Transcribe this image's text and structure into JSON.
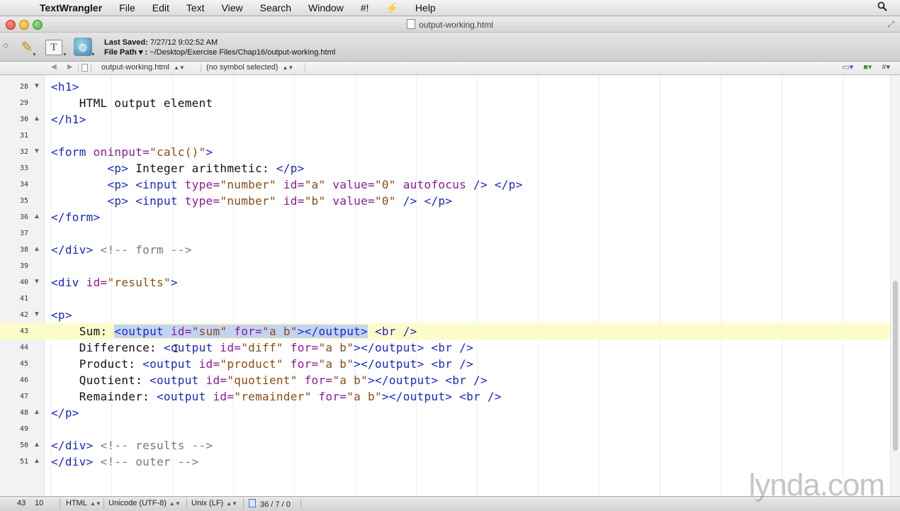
{
  "menubar": {
    "apple": "",
    "app_name": "TextWrangler",
    "items": [
      "File",
      "Edit",
      "Text",
      "View",
      "Search",
      "Window",
      "#!",
      "⚡",
      "Help"
    ],
    "spotlight_icon": "search-icon"
  },
  "window": {
    "title": "output-working.html"
  },
  "toolbar": {
    "last_saved_label": "Last Saved:",
    "last_saved_value": "7/27/12 9:02:52 AM",
    "file_path_label": "File Path ▾ :",
    "file_path_value": "~/Desktop/Exercise Files/Chap16/output-working.html"
  },
  "navbar": {
    "file": "output-working.html",
    "symbol": "(no symbol selected)"
  },
  "editor": {
    "current_line": 43,
    "lines": [
      {
        "n": "28",
        "fold": "▼"
      },
      {
        "n": "29",
        "fold": ""
      },
      {
        "n": "30",
        "fold": "▲"
      },
      {
        "n": "31",
        "fold": ""
      },
      {
        "n": "32",
        "fold": "▼"
      },
      {
        "n": "33",
        "fold": ""
      },
      {
        "n": "34",
        "fold": ""
      },
      {
        "n": "35",
        "fold": ""
      },
      {
        "n": "36",
        "fold": "▲"
      },
      {
        "n": "37",
        "fold": ""
      },
      {
        "n": "38",
        "fold": "▲"
      },
      {
        "n": "39",
        "fold": ""
      },
      {
        "n": "40",
        "fold": "▼"
      },
      {
        "n": "41",
        "fold": ""
      },
      {
        "n": "42",
        "fold": "▼"
      },
      {
        "n": "43",
        "fold": ""
      },
      {
        "n": "44",
        "fold": ""
      },
      {
        "n": "45",
        "fold": ""
      },
      {
        "n": "46",
        "fold": ""
      },
      {
        "n": "47",
        "fold": ""
      },
      {
        "n": "48",
        "fold": "▲"
      },
      {
        "n": "49",
        "fold": ""
      },
      {
        "n": "50",
        "fold": "▲"
      },
      {
        "n": "51",
        "fold": "▲"
      }
    ],
    "code": {
      "l28": "<h1>",
      "l29": "    HTML output element",
      "l30": "</h1>",
      "l32_tag": "<form ",
      "l32_attr": "oninput=",
      "l32_str": "\"calc()\"",
      "l32_end": ">",
      "l33_indent": "        ",
      "l33_open": "<p>",
      "l33_text": " Integer arithmetic: ",
      "l33_close": "</p>",
      "l34_indent": "        ",
      "l34_p": "<p>",
      "l34_input": " <input ",
      "l34_type": "type=",
      "l34_typev": "\"number\"",
      "l34_id": " id=",
      "l34_idv": "\"a\"",
      "l34_val": " value=",
      "l34_valv": "\"0\"",
      "l34_auto": " autofocus",
      "l34_end": " /> </p>",
      "l35_indent": "        ",
      "l35_p": "<p>",
      "l35_input": " <input ",
      "l35_type": "type=",
      "l35_typev": "\"number\"",
      "l35_id": " id=",
      "l35_idv": "\"b\"",
      "l35_val": " value=",
      "l35_valv": "\"0\"",
      "l35_end": " /> </p>",
      "l36": "</form>",
      "l38_tag": "</div>",
      "l38_cmt": " <!-- form -->",
      "l40_tag": "<div ",
      "l40_attr": "id=",
      "l40_str": "\"results\"",
      "l40_end": ">",
      "l42": "<p>",
      "l43_text": "    Sum: ",
      "l43_o1": "<output ",
      "l43_a1": "id=",
      "l43_s1": "\"sum\"",
      "l43_a2": " for=",
      "l43_s2": "\"a b\"",
      "l43_o2": "></output>",
      "l43_br": " <br />",
      "l44_text": "    Difference: ",
      "l44_o1": "<output ",
      "l44_a1": "id=",
      "l44_s1": "\"diff\"",
      "l44_a2": " for=",
      "l44_s2": "\"a b\"",
      "l44_o2": "></output>",
      "l44_br": " <br />",
      "l45_text": "    Product: ",
      "l45_o1": "<output ",
      "l45_a1": "id=",
      "l45_s1": "\"product\"",
      "l45_a2": " for=",
      "l45_s2": "\"a b\"",
      "l45_o2": "></output>",
      "l45_br": " <br />",
      "l46_text": "    Quotient: ",
      "l46_o1": "<output ",
      "l46_a1": "id=",
      "l46_s1": "\"quotient\"",
      "l46_a2": " for=",
      "l46_s2": "\"a b\"",
      "l46_o2": "></output>",
      "l46_br": " <br />",
      "l47_text": "    Remainder: ",
      "l47_o1": "<output ",
      "l47_a1": "id=",
      "l47_s1": "\"remainder\"",
      "l47_a2": " for=",
      "l47_s2": "\"a b\"",
      "l47_o2": "></output>",
      "l47_br": " <br />",
      "l48": "</p>",
      "l50_tag": "</div>",
      "l50_cmt": " <!-- results -->",
      "l51_tag": "</div>",
      "l51_cmt": " <!-- outer -->"
    }
  },
  "statusbar": {
    "line": "43",
    "column": "10",
    "language": "HTML",
    "encoding": "Unicode (UTF-8)",
    "line_endings": "Unix (LF)",
    "stats": "36 / 7 / 0"
  },
  "watermark": "lynda.com",
  "colors": {
    "tag": "#1a26c9",
    "attribute": "#8d1896",
    "string": "#8a4b12",
    "comment": "#7a7a7a",
    "current_line": "#fdfcc9",
    "selection": "#c3d4f0"
  }
}
